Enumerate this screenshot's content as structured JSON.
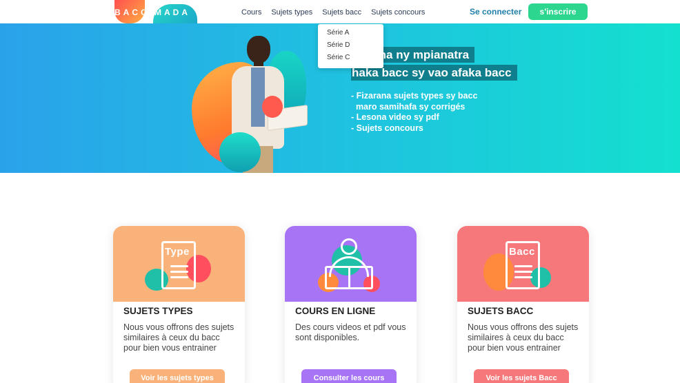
{
  "nav": {
    "logo": "BACC MADA",
    "links": [
      "Cours",
      "Sujets types",
      "Sujets bacc",
      "Sujets concours"
    ],
    "login": "Se connecter",
    "signup": "s'inscrire"
  },
  "dropdown": {
    "items": [
      "Série A",
      "Série D",
      "Série C"
    ]
  },
  "hero": {
    "title_line1": "mpiana ny mpianatra",
    "title_line2": "haka bacc sy vao afaka bacc",
    "features": [
      "- Fizarana sujets types sy bacc",
      "  maro samihafa sy corrigés",
      "- Lesona video sy pdf",
      "- Sujets concours"
    ]
  },
  "cards": [
    {
      "title": "SUJETS TYPES",
      "icon_label": "Type",
      "description": "Nous vous offrons des sujets similaires à ceux du bacc pour bien vous entrainer",
      "button": "Voir les sujets types",
      "color": "#f9b27a"
    },
    {
      "title": "COURS EN LIGNE",
      "description": "Des cours videos et pdf vous sont disponibles.",
      "button": "Consulter les cours",
      "color": "#a774f5"
    },
    {
      "title": "SUJETS BACC",
      "icon_label": "Bacc",
      "description": "Nous vous offrons des sujets similaires à ceux du bacc pour bien vous entrainer",
      "button": "Voir les sujets Bacc",
      "color": "#f7787a"
    }
  ]
}
